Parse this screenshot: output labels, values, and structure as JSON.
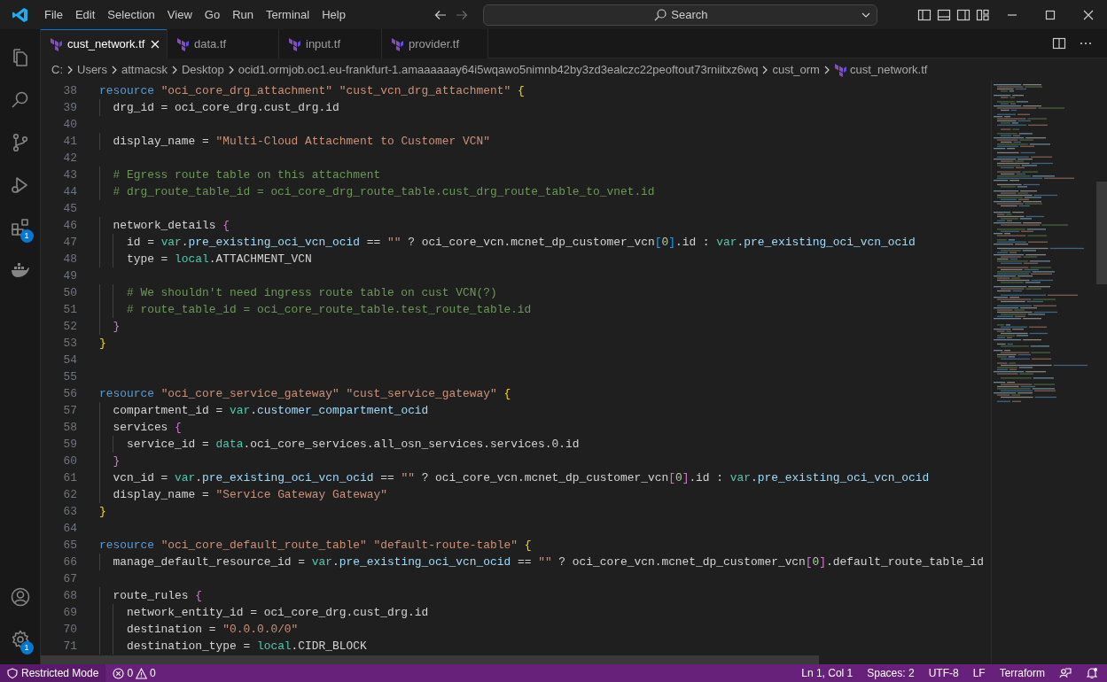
{
  "title_bar": {
    "menu": [
      "File",
      "Edit",
      "Selection",
      "View",
      "Go",
      "Run",
      "Terminal",
      "Help"
    ],
    "search": "Search"
  },
  "activity_bar": {
    "extensions_badge": "1",
    "settings_badge": "1"
  },
  "tabs": [
    {
      "label": "cust_network.tf",
      "selected": true
    },
    {
      "label": "data.tf",
      "selected": false
    },
    {
      "label": "input.tf",
      "selected": false
    },
    {
      "label": "provider.tf",
      "selected": false
    }
  ],
  "breadcrumb": [
    "C:",
    "Users",
    "attmacsk",
    "Desktop",
    "ocid1.ormjob.oc1.eu-frankfurt-1.amaaaaaay64i5wqawo5nimnb42by3zd3ealczc22peoftout73rniitxz6wq",
    "cust_orm",
    "cust_network.tf"
  ],
  "editor": {
    "lines": [
      {
        "number": "38",
        "tokens": [
          {
            "kind": "keyword",
            "text": "resource "
          },
          {
            "kind": "string",
            "text": "\"oci_core_drg_attachment\" \"cust_vcn_drg_attachment\" "
          },
          {
            "kind": "brace1",
            "text": "{"
          }
        ]
      },
      {
        "number": "39",
        "tokens": [
          {
            "kind": "plain",
            "text": "  drg_id = oci_core_drg.cust_drg.id"
          }
        ]
      },
      {
        "number": "40"
      },
      {
        "number": "41",
        "tokens": [
          {
            "kind": "plain",
            "text": "  display_name = "
          },
          {
            "kind": "string",
            "text": "\"Multi-Cloud Attachment to Customer VCN\""
          }
        ]
      },
      {
        "number": "42"
      },
      {
        "number": "43",
        "tokens": [
          {
            "kind": "comment",
            "text": "  # Egress route table on this attachment"
          }
        ]
      },
      {
        "number": "44",
        "tokens": [
          {
            "kind": "comment",
            "text": "  # drg_route_table_id = oci_core_drg_route_table.cust_drg_route_table_to_vnet.id"
          }
        ]
      },
      {
        "number": "45"
      },
      {
        "number": "46",
        "tokens": [
          {
            "kind": "plain",
            "text": "  network_details "
          },
          {
            "kind": "brace2",
            "text": "{"
          }
        ]
      },
      {
        "number": "47",
        "tokens": [
          {
            "kind": "plain",
            "text": "    id = "
          },
          {
            "kind": "builtin",
            "text": "var"
          },
          {
            "kind": "plain",
            "text": "."
          },
          {
            "kind": "property",
            "text": "pre_existing_oci_vcn_ocid"
          },
          {
            "kind": "plain",
            "text": " == "
          },
          {
            "kind": "string",
            "text": "\"\""
          },
          {
            "kind": "plain",
            "text": " ? oci_core_vcn.mcnet_dp_customer_vcn"
          },
          {
            "kind": "brace3",
            "text": "["
          },
          {
            "kind": "number",
            "text": "0"
          },
          {
            "kind": "brace3",
            "text": "]"
          },
          {
            "kind": "plain",
            "text": ".id : "
          },
          {
            "kind": "builtin",
            "text": "var"
          },
          {
            "kind": "plain",
            "text": "."
          },
          {
            "kind": "property",
            "text": "pre_existing_oci_vcn_ocid"
          }
        ]
      },
      {
        "number": "48",
        "tokens": [
          {
            "kind": "plain",
            "text": "    type = "
          },
          {
            "kind": "builtin",
            "text": "local"
          },
          {
            "kind": "plain",
            "text": ".ATTACHMENT_VCN"
          }
        ]
      },
      {
        "number": "49"
      },
      {
        "number": "50",
        "tokens": [
          {
            "kind": "comment",
            "text": "    # We shouldn't need ingress route table on cust VCN(?)"
          }
        ]
      },
      {
        "number": "51",
        "tokens": [
          {
            "kind": "comment",
            "text": "    # route_table_id = oci_core_route_table.test_route_table.id"
          }
        ]
      },
      {
        "number": "52",
        "tokens": [
          {
            "kind": "brace2",
            "text": "  }"
          }
        ]
      },
      {
        "number": "53",
        "tokens": [
          {
            "kind": "brace1",
            "text": "}"
          }
        ]
      },
      {
        "number": "54"
      },
      {
        "number": "55"
      },
      {
        "number": "56",
        "tokens": [
          {
            "kind": "keyword",
            "text": "resource "
          },
          {
            "kind": "string",
            "text": "\"oci_core_service_gateway\" \"cust_service_gateway\" "
          },
          {
            "kind": "brace1",
            "text": "{"
          }
        ]
      },
      {
        "number": "57",
        "tokens": [
          {
            "kind": "plain",
            "text": "  compartment_id = "
          },
          {
            "kind": "builtin",
            "text": "var"
          },
          {
            "kind": "plain",
            "text": "."
          },
          {
            "kind": "property",
            "text": "customer_compartment_ocid"
          }
        ]
      },
      {
        "number": "58",
        "tokens": [
          {
            "kind": "plain",
            "text": "  services "
          },
          {
            "kind": "brace2",
            "text": "{"
          }
        ]
      },
      {
        "number": "59",
        "tokens": [
          {
            "kind": "plain",
            "text": "    service_id = "
          },
          {
            "kind": "builtin",
            "text": "data"
          },
          {
            "kind": "plain",
            "text": ".oci_core_services.all_osn_services.services.0.id"
          }
        ]
      },
      {
        "number": "60",
        "tokens": [
          {
            "kind": "brace2",
            "text": "  }"
          }
        ]
      },
      {
        "number": "61",
        "tokens": [
          {
            "kind": "plain",
            "text": "  vcn_id = "
          },
          {
            "kind": "builtin",
            "text": "var"
          },
          {
            "kind": "plain",
            "text": "."
          },
          {
            "kind": "property",
            "text": "pre_existing_oci_vcn_ocid"
          },
          {
            "kind": "plain",
            "text": " == "
          },
          {
            "kind": "string",
            "text": "\"\""
          },
          {
            "kind": "plain",
            "text": " ? oci_core_vcn.mcnet_dp_customer_vcn"
          },
          {
            "kind": "brace2",
            "text": "["
          },
          {
            "kind": "number",
            "text": "0"
          },
          {
            "kind": "brace2",
            "text": "]"
          },
          {
            "kind": "plain",
            "text": ".id : "
          },
          {
            "kind": "builtin",
            "text": "var"
          },
          {
            "kind": "plain",
            "text": "."
          },
          {
            "kind": "property",
            "text": "pre_existing_oci_vcn_ocid"
          }
        ]
      },
      {
        "number": "62",
        "tokens": [
          {
            "kind": "plain",
            "text": "  display_name = "
          },
          {
            "kind": "string",
            "text": "\"Service Gateway Gateway\""
          }
        ]
      },
      {
        "number": "63",
        "tokens": [
          {
            "kind": "brace1",
            "text": "}"
          }
        ]
      },
      {
        "number": "64"
      },
      {
        "number": "65",
        "tokens": [
          {
            "kind": "keyword",
            "text": "resource "
          },
          {
            "kind": "string",
            "text": "\"oci_core_default_route_table\" \"default-route-table\" "
          },
          {
            "kind": "brace1",
            "text": "{"
          }
        ]
      },
      {
        "number": "66",
        "tokens": [
          {
            "kind": "plain",
            "text": "  manage_default_resource_id = "
          },
          {
            "kind": "builtin",
            "text": "var"
          },
          {
            "kind": "plain",
            "text": "."
          },
          {
            "kind": "property",
            "text": "pre_existing_oci_vcn_ocid"
          },
          {
            "kind": "plain",
            "text": " == "
          },
          {
            "kind": "string",
            "text": "\"\""
          },
          {
            "kind": "plain",
            "text": " ? oci_core_vcn.mcnet_dp_customer_vcn"
          },
          {
            "kind": "brace2",
            "text": "["
          },
          {
            "kind": "number",
            "text": "0"
          },
          {
            "kind": "brace2",
            "text": "]"
          },
          {
            "kind": "plain",
            "text": ".default_route_table_id"
          }
        ]
      },
      {
        "number": "67"
      },
      {
        "number": "68",
        "tokens": [
          {
            "kind": "plain",
            "text": "  route_rules "
          },
          {
            "kind": "brace2",
            "text": "{"
          }
        ]
      },
      {
        "number": "69",
        "tokens": [
          {
            "kind": "plain",
            "text": "    network_entity_id = oci_core_drg.cust_drg.id"
          }
        ]
      },
      {
        "number": "70",
        "tokens": [
          {
            "kind": "plain",
            "text": "    destination = "
          },
          {
            "kind": "string",
            "text": "\"0.0.0.0/0\""
          }
        ]
      },
      {
        "number": "71",
        "tokens": [
          {
            "kind": "plain",
            "text": "    destination_type = "
          },
          {
            "kind": "builtin",
            "text": "local"
          },
          {
            "kind": "plain",
            "text": ".CIDR_BLOCK"
          }
        ]
      }
    ]
  },
  "status_bar": {
    "restricted_mode": "Restricted Mode",
    "errors": "0",
    "warnings": "0",
    "items": [
      "Ln 1, Col 1",
      "Spaces: 2",
      "UTF-8",
      "LF",
      "Terraform"
    ]
  }
}
